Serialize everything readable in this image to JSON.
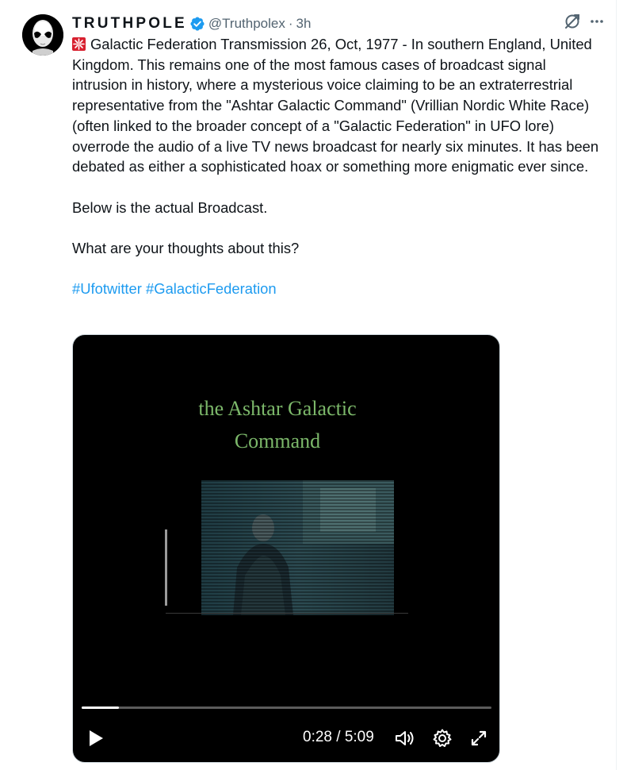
{
  "post": {
    "display_name": "TRUTHPOLE",
    "handle": "@Truthpolex",
    "separator": "·",
    "time": "3h",
    "text_line1": "Galactic Federation Transmission 26, Oct, 1977 - In southern England, United Kingdom. This remains one of the most famous cases of broadcast signal intrusion in history, where a mysterious voice claiming to be an extraterrestrial representative from the \"Ashtar Galactic Command\" (Vrillian Nordic White Race) (often linked to the broader concept of a \"Galactic Federation\" in UFO lore) overrode the audio of a live TV news broadcast for nearly six minutes. It has been debated as either a sophisticated hoax or something more enigmatic ever since.",
    "text_line2": "Below is the actual Broadcast.",
    "text_line3": "What are your thoughts about this?",
    "hashtags": [
      "#Ufotwitter",
      "#GalacticFederation"
    ]
  },
  "video": {
    "caption_line1": "the Ashtar Galactic",
    "caption_line2": "Command",
    "time_display": "0:28 / 5:09",
    "progress": 0.091,
    "caption_color": "#7cb86a"
  },
  "colors": {
    "accent": "#1d9bf0",
    "secondary_text": "#536471"
  },
  "icons": [
    "alien-avatar",
    "verified-badge-icon",
    "grok-icon",
    "more-icon",
    "siren-emoji",
    "play-icon",
    "volume-icon",
    "settings-gear-icon",
    "fullscreen-icon"
  ]
}
